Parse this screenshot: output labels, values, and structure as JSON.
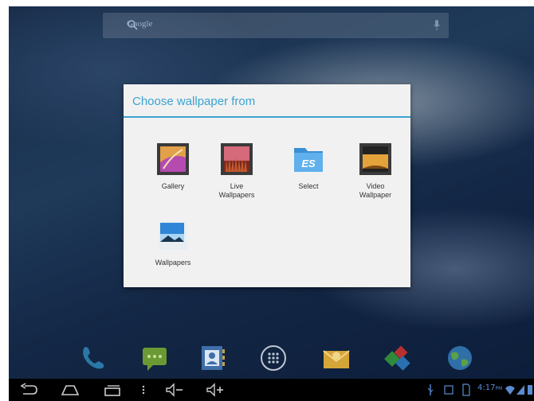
{
  "search": {
    "placeholder": "Google"
  },
  "dialog": {
    "title": "Choose wallpaper from",
    "options": [
      {
        "label": "Gallery",
        "icon": "gallery-icon"
      },
      {
        "label": "Live\nWallpapers",
        "icon": "live-wallpapers-icon"
      },
      {
        "label": "Select",
        "icon": "es-file-explorer-icon"
      },
      {
        "label": "Video\nWallpaper",
        "icon": "video-wallpaper-icon"
      },
      {
        "label": "Wallpapers",
        "icon": "wallpapers-icon"
      }
    ]
  },
  "dock": [
    "phone-icon",
    "messaging-icon",
    "contacts-icon",
    "app-drawer-icon",
    "email-icon",
    "app-icon",
    "browser-icon"
  ],
  "navbar": {
    "buttons": [
      "back-icon",
      "home-icon",
      "recent-apps-icon",
      "menu-icon",
      "volume-down-icon",
      "volume-up-icon"
    ],
    "time": "4:17",
    "ampm": "PM"
  },
  "colors": {
    "accent": "#3aa3d0",
    "dialog_bg": "#f1f1f1",
    "navbar_bg": "#000000"
  }
}
